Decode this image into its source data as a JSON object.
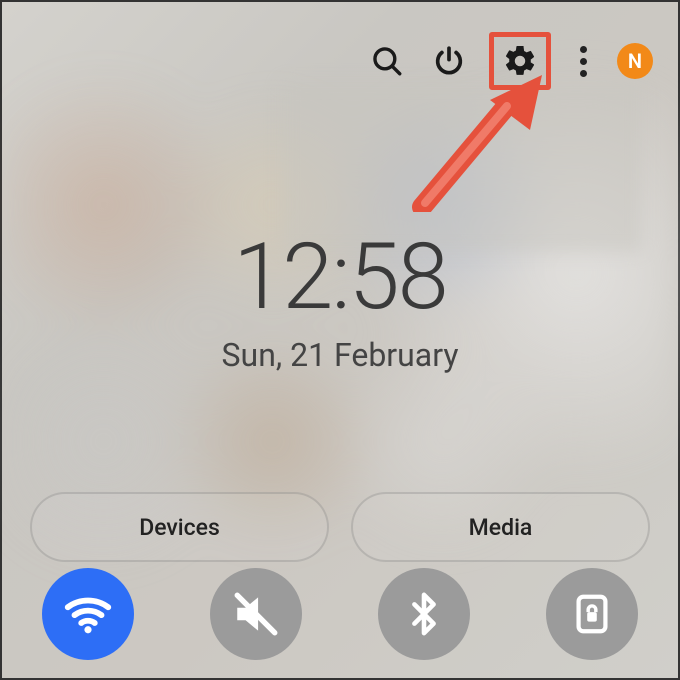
{
  "clock": {
    "time": "12:58",
    "date": "Sun, 21 February"
  },
  "pills": {
    "devices": "Devices",
    "media": "Media"
  },
  "avatar": {
    "initial": "N",
    "color": "#f28918"
  },
  "annotation": {
    "highlight_color": "#e5513c"
  },
  "icons": {
    "search": "search-icon",
    "power": "power-icon",
    "settings": "gear-icon",
    "overflow": "more-vert-icon"
  },
  "toggles": [
    {
      "name": "wifi",
      "active": true
    },
    {
      "name": "mute",
      "active": false
    },
    {
      "name": "bluetooth",
      "active": false
    },
    {
      "name": "rotation-lock",
      "active": false
    }
  ]
}
